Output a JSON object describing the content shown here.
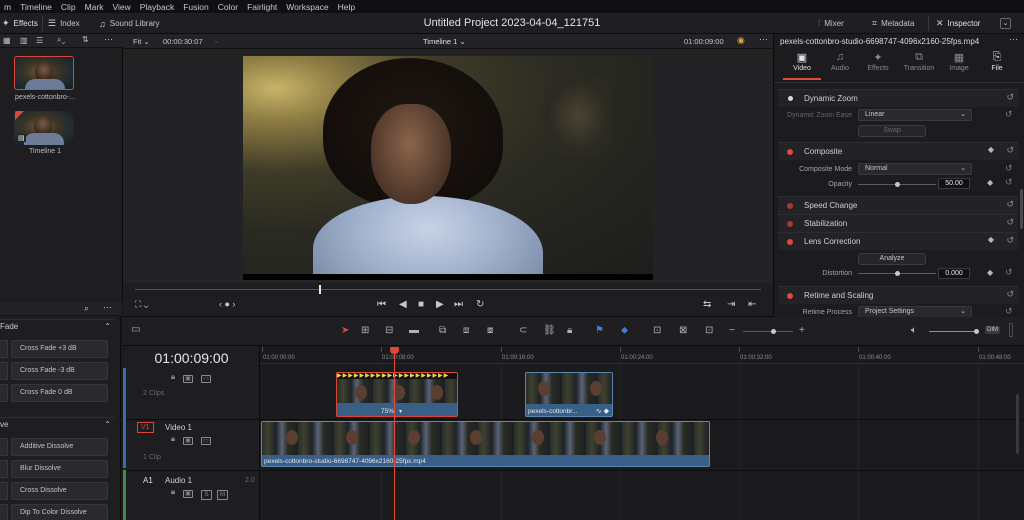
{
  "menu": [
    "m",
    "Timeline",
    "Clip",
    "Mark",
    "View",
    "Playback",
    "Fusion",
    "Color",
    "Fairlight",
    "Workspace",
    "Help"
  ],
  "toolbar": {
    "effects": "Effects",
    "index": "Index",
    "sound_library": "Sound Library",
    "project_title": "Untitled Project 2023-04-04_121751",
    "mixer": "Mixer",
    "metadata": "Metadata",
    "inspector": "Inspector"
  },
  "media_pool": {
    "clip_label": "pexels-cottonbro-...",
    "timeline_label": "Timeline 1"
  },
  "viewer": {
    "fit": "Fit",
    "source_timecode": "00:00:30:07",
    "timeline_name": "Timeline 1",
    "record_timecode": "01:00:09:00"
  },
  "inspector": {
    "title": "pexels-cottonbro-studio-6698747-4096x2160-25fps.mp4",
    "tabs": [
      "Video",
      "Audio",
      "Effects",
      "Transition",
      "Image",
      "File"
    ],
    "dynamic_zoom": "Dynamic Zoom",
    "dynamic_zoom_ease_label": "Dynamic Zoom Ease",
    "dynamic_zoom_ease_value": "Linear",
    "swap": "Swap",
    "composite": "Composite",
    "composite_mode_label": "Composite Mode",
    "composite_mode_value": "Normal",
    "opacity_label": "Opacity",
    "opacity_value": "50.00",
    "speed_change": "Speed Change",
    "stabilization": "Stabilization",
    "lens_correction": "Lens Correction",
    "analyze": "Analyze",
    "distortion_label": "Distortion",
    "distortion_value": "0.000",
    "retime_scaling": "Retime and Scaling",
    "retime_process_label": "Retime Process",
    "retime_process_value": "Project Settings"
  },
  "effects_panel": {
    "group1": "Fade",
    "items1": [
      "Cross Fade +3 dB",
      "Cross Fade -3 dB",
      "Cross Fade 0 dB"
    ],
    "group2": "ve",
    "items2": [
      "Additive Dissolve",
      "Blur Dissolve",
      "Cross Dissolve",
      "Dip To Color Dissolve"
    ]
  },
  "timeline": {
    "timecode": "01:00:09:00",
    "v2_count": "2 Clips",
    "v1_badge": "V1",
    "v1_name": "Video 1",
    "v1_count": "1 Clip",
    "a1_badge": "A1",
    "a1_name": "Audio 1",
    "a1_channels": "2.0",
    "ruler": [
      "01:00:00:00",
      "01:00:08:00",
      "01:00:16:00",
      "01:00:24:00",
      "01:00:32:00",
      "01:00:40:00",
      "01:00:48:00"
    ],
    "v2_clip1_label": "75%",
    "v2_clip2_label": "pexels-cottonbr...",
    "v1_clip_label": "pexels-cottonbro-studio-6698747-4096x2160-25fps.mp4"
  },
  "colors": {
    "accent": "#e2453a",
    "clip_blue": "#3a5f86",
    "audio_green": "#3c8a4c"
  }
}
